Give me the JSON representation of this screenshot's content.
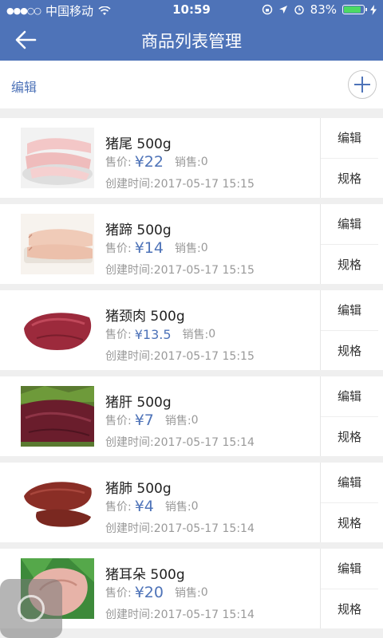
{
  "status_bar": {
    "carrier": "中国移动",
    "time": "10:59",
    "battery": "83%"
  },
  "nav": {
    "title": "商品列表管理"
  },
  "toolbar": {
    "edit_label": "编辑"
  },
  "labels": {
    "price": "售价:",
    "sales": "销售:",
    "edit": "编辑",
    "spec": "规格"
  },
  "products": [
    {
      "name": "猪尾 500g",
      "price": "¥22",
      "sales": "0",
      "created": "创建时间:2017-05-17 15:15"
    },
    {
      "name": "猪蹄 500g",
      "price": "¥14",
      "sales": "0",
      "created": "创建时间:2017-05-17 15:15"
    },
    {
      "name": "猪颈肉 500g",
      "price": "¥13.5",
      "sales": "0",
      "created": "创建时间:2017-05-17 15:15"
    },
    {
      "name": "猪肝 500g",
      "price": "¥7",
      "sales": "0",
      "created": "创建时间:2017-05-17 15:14"
    },
    {
      "name": "猪肺 500g",
      "price": "¥4",
      "sales": "0",
      "created": "创建时间:2017-05-17 15:14"
    },
    {
      "name": "猪耳朵 500g",
      "price": "¥20",
      "sales": "0",
      "created": "创建时间:2017-05-17 15:14"
    }
  ],
  "colors": {
    "brand": "#4e73b8",
    "battery": "#4cd964"
  }
}
